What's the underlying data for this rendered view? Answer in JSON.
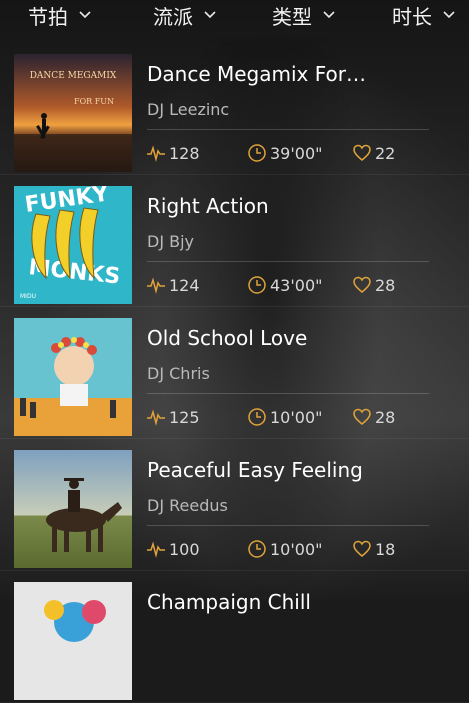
{
  "filters": [
    {
      "label": "节拍"
    },
    {
      "label": "流派"
    },
    {
      "label": "类型"
    },
    {
      "label": "时长"
    }
  ],
  "colors": {
    "accent": "#e0a33a",
    "background": "#1b1b1b",
    "text": "#ffffff",
    "secondary_text": "#b9b9b9"
  },
  "icons": {
    "bpm": "heartbeat-icon",
    "duration": "clock-icon",
    "likes": "heart-icon",
    "filter_toggle": "chevron-down-icon"
  },
  "mixes": [
    {
      "title": "Dance Megamix For…",
      "artist": "DJ Leezinc",
      "bpm": "128",
      "duration": "39'00\"",
      "likes": "22",
      "cover_text": [
        "DANCE MEGAMIX",
        "FOR FUN"
      ]
    },
    {
      "title": "Right Action",
      "artist": "DJ Bjy",
      "bpm": "124",
      "duration": "43'00\"",
      "likes": "28",
      "cover_text": [
        "FUNKY",
        "MONKS",
        "MIDU"
      ]
    },
    {
      "title": "Old School Love",
      "artist": "DJ Chris",
      "bpm": "125",
      "duration": "10'00\"",
      "likes": "28"
    },
    {
      "title": "Peaceful Easy Feeling",
      "artist": "DJ Reedus",
      "bpm": "100",
      "duration": "10'00\"",
      "likes": "18"
    },
    {
      "title": "Champaign Chill",
      "artist": "",
      "bpm": "",
      "duration": "",
      "likes": ""
    }
  ]
}
